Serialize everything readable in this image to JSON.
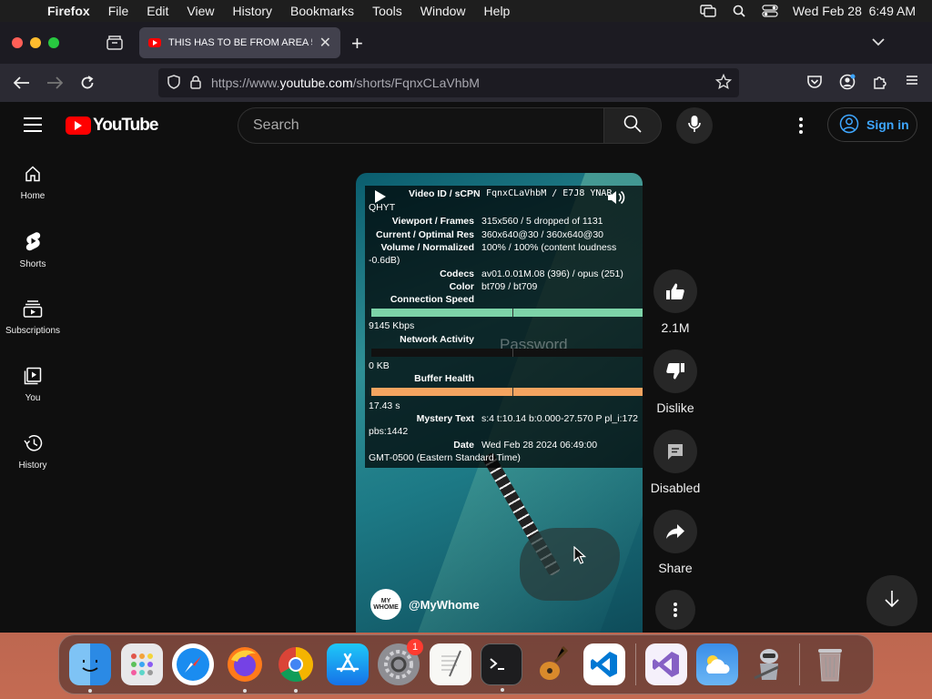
{
  "menubar": {
    "app": "Firefox",
    "items": [
      "File",
      "Edit",
      "View",
      "History",
      "Bookmarks",
      "Tools",
      "Window",
      "Help"
    ],
    "datetime": "Wed Feb 28  6:49 AM"
  },
  "browser": {
    "tab_title": "THIS HAS TO BE FROM AREA 5",
    "url_prefix": "https://www.",
    "url_domain": "youtube.com",
    "url_path": "/shorts/FqnxCLaVhbM"
  },
  "youtube": {
    "logo_text": "YouTube",
    "search_placeholder": "Search",
    "sign_in_label": "Sign in",
    "guide": [
      {
        "label": "Home"
      },
      {
        "label": "Shorts"
      },
      {
        "label": "Subscriptions"
      },
      {
        "label": "You"
      },
      {
        "label": "History"
      }
    ]
  },
  "stats": {
    "video_id_label": "Video ID / sCPN",
    "video_id_value": "FqnxCLaVhbM  /  E7J8  YNAR",
    "video_id_wrap": "QHYT",
    "viewport_label": "Viewport / Frames",
    "viewport_value": "315x560 / 5 dropped of 1131",
    "res_label": "Current / Optimal Res",
    "res_value": "360x640@30 / 360x640@30",
    "volume_label": "Volume / Normalized",
    "volume_value": "100% / 100% (content loudness",
    "volume_wrap": "-0.6dB)",
    "codecs_label": "Codecs",
    "codecs_value": "av01.0.01M.08 (396) / opus (251)",
    "color_label": "Color",
    "color_value": "bt709 / bt709",
    "speed_label": "Connection Speed",
    "speed_value": "9145 Kbps",
    "network_label": "Network Activity",
    "network_value": "0 KB",
    "buffer_label": "Buffer Health",
    "buffer_value": "17.43 s",
    "mystery_label": "Mystery Text",
    "mystery_value": "s:4 t:10.14 b:0.000-27.570 P pl_i:172",
    "mystery_wrap": "pbs:1442",
    "date_label": "Date",
    "date_value": "Wed Feb 28 2024 06:49:00",
    "date_wrap": "GMT-0500 (Eastern Standard Time)",
    "overlay_text": "Password"
  },
  "short": {
    "channel_handle": "@MyWhome",
    "avatar_text": "MY WHOME"
  },
  "actions": {
    "like_count": "2.1M",
    "dislike_label": "Dislike",
    "comments_label": "Disabled",
    "share_label": "Share"
  },
  "dock": {
    "settings_badge": "1",
    "apps": [
      "finder-icon",
      "launchpad-icon",
      "safari-icon",
      "firefox-icon",
      "chrome-icon",
      "app-store-icon",
      "system-settings-icon",
      "textedit-icon",
      "terminal-icon",
      "garageband-icon",
      "vscode-icon",
      "visual-studio-icon",
      "weather-icon",
      "automator-icon",
      "trash-icon"
    ]
  },
  "colors": {
    "yt_red": "#ff0000",
    "link_blue": "#3ea6ff",
    "speed_bar": "#7dd3a8",
    "buffer_bar": "#f4a460"
  }
}
